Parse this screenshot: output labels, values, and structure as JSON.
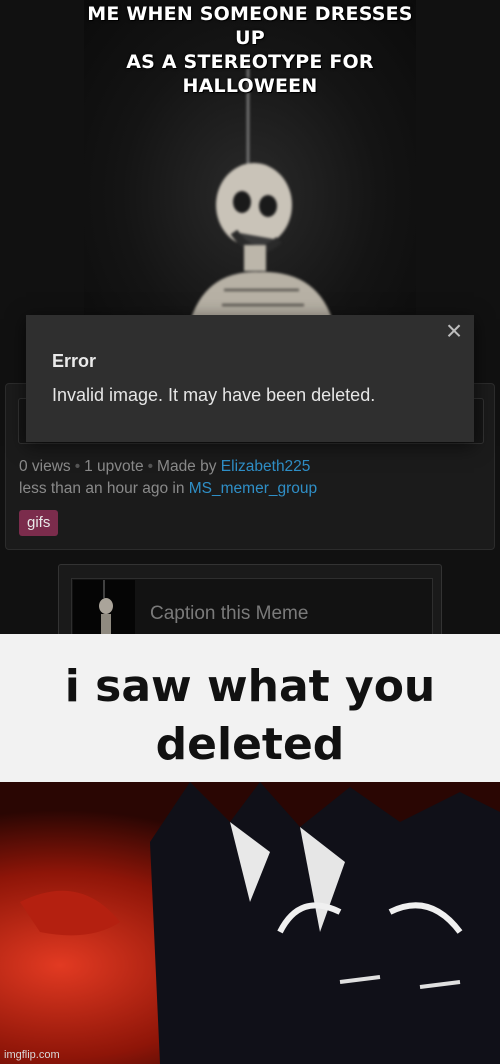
{
  "meme": {
    "caption_line1": "ME WHEN SOMEONE DRESSES UP",
    "caption_line2": "AS A STEREOTYPE FOR HALLOWEEN"
  },
  "meta": {
    "views": "0 views",
    "upvotes": "1 upvote",
    "made_by_label": "Made by",
    "author": "Elizabeth225",
    "time_label": "less than an hour ago in",
    "stream": "MS_memer_group",
    "tag": "gifs"
  },
  "error": {
    "title": "Error",
    "message": "Invalid image. It may have been deleted.",
    "close_symbol": "×"
  },
  "caption_bar": {
    "placeholder": "Caption this Meme"
  },
  "reaction": {
    "line1": "i saw what you",
    "line2": "deleted"
  },
  "watermark": "imgflip.com"
}
